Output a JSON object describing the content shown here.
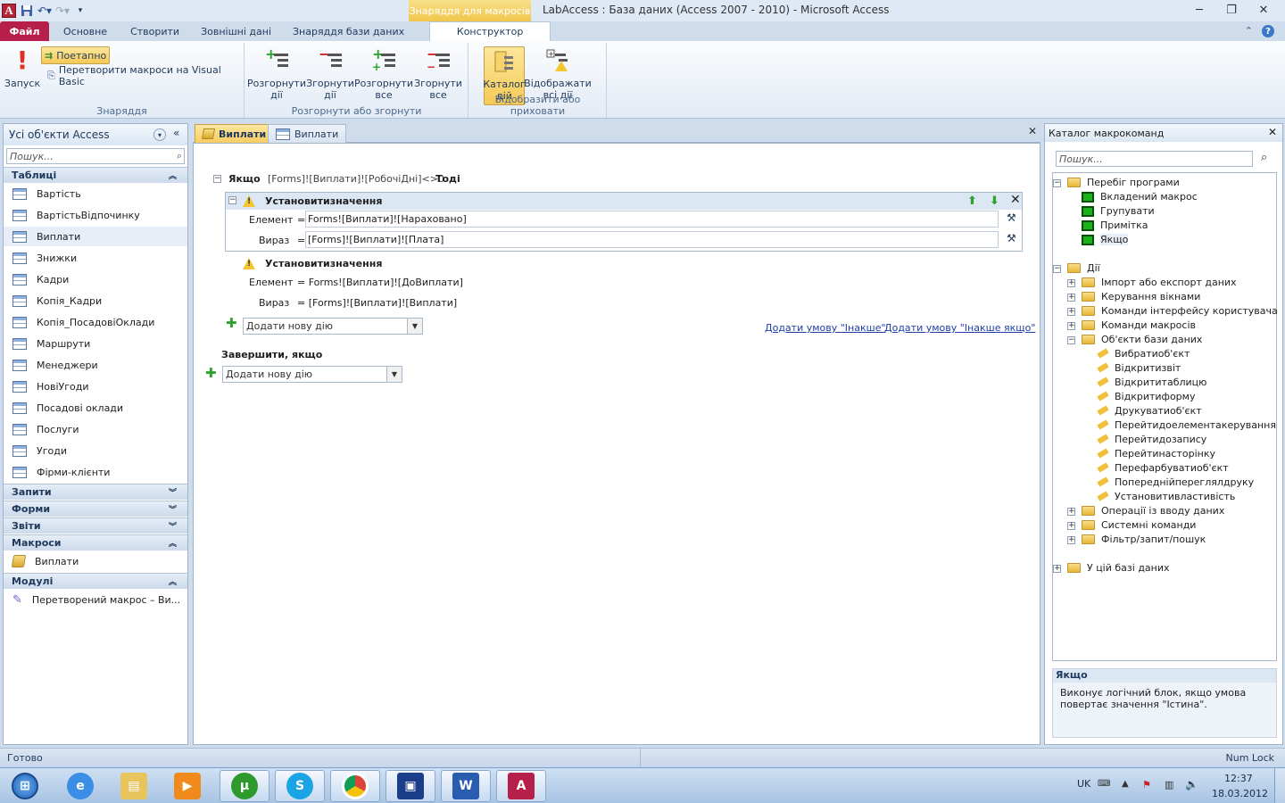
{
  "window": {
    "title": "LabAccess : База даних (Access 2007 - 2010)  -  Microsoft Access",
    "contextual_tab_header": "Знаряддя для макросів"
  },
  "tabs": [
    "Файл",
    "Основне",
    "Створити",
    "Зовнішні дані",
    "Знаряддя бази даних",
    "Конструктор"
  ],
  "ribbon": {
    "tools": {
      "label": "Знаряддя",
      "run": "Запуск",
      "step": "Поетапно",
      "convert": "Перетворити макроси на Visual Basic"
    },
    "expand": {
      "label": "Розгорнути або згорнути",
      "b1": [
        "Розгорнути",
        "дії"
      ],
      "b2": [
        "Згорнути",
        "дії"
      ],
      "b3": [
        "Розгорнути",
        "все"
      ],
      "b4": [
        "Згорнути",
        "все"
      ]
    },
    "show": {
      "label": "Відобразити або приховати",
      "b1": [
        "Каталог",
        "дій"
      ],
      "b2": [
        "Відображати",
        "всі дії"
      ]
    }
  },
  "nav": {
    "header": "Усі об'єкти Access",
    "search_placeholder": "Пошук...",
    "cat_tables": "Таблиці",
    "tables": [
      "Вартість",
      "ВартістьВідпочинку",
      "Виплати",
      "Знижки",
      "Кадри",
      "Копія_Кадри",
      "Копія_ПосадовіОклади",
      "Маршрути",
      "Менеджери",
      "НовіУгоди",
      "Посадові оклади",
      "Послуги",
      "Угоди",
      "Фірми-клієнти"
    ],
    "cat_queries": "Запити",
    "cat_forms": "Форми",
    "cat_reports": "Звіти",
    "cat_macros": "Макроси",
    "macros": [
      "Виплати"
    ],
    "cat_modules": "Модулі",
    "modules": [
      "Перетворений макрос – Ви..."
    ]
  },
  "doc_tabs": [
    "Виплати",
    "Виплати"
  ],
  "macro": {
    "if_kw": "Якщо",
    "if_cond": "[Forms]![Виплати]![РобочіДні]<>0",
    "then_kw": "Тоді",
    "action1": {
      "name": "Установитизначення",
      "elem_label": "Елемент",
      "elem_val": "Forms![Виплати]![Нараховано]",
      "expr_label": "Вираз",
      "expr_val": "[Forms]![Виплати]![Плата]"
    },
    "action2": {
      "name": "Установитизначення",
      "elem_label": "Елемент",
      "elem_val": "= Forms![Виплати]![ДоВиплати]",
      "expr_label": "Вираз",
      "expr_val": "= [Forms]![Виплати]![Виплати]"
    },
    "eq": "=",
    "add_action": "Додати нову дію",
    "add_else": "Додати умову \"Інакше\"",
    "add_elseif": "Додати умову \"Інакше якщо\"",
    "end_if": "Завершити, якщо"
  },
  "catalog": {
    "title": "Каталог макрокоманд",
    "search_placeholder": "Пошук...",
    "program_flow": "Перебіг програми",
    "flow_items": [
      "Вкладений макрос",
      "Групувати",
      "Примітка",
      "Якщо"
    ],
    "actions": "Дії",
    "action_groups": [
      "Імпорт або експорт даних",
      "Керування вікнами",
      "Команди інтерфейсу користувача",
      "Команди макросів",
      "Об'єкти бази даних"
    ],
    "db_object_items": [
      "Вибратиоб'єкт",
      "Відкритизвіт",
      "Відкрититаблицю",
      "Відкритиформу",
      "Друкуватиоб'єкт",
      "Перейтидоелементакерування",
      "Перейтидозапису",
      "Перейтинасторінку",
      "Перефарбуватиоб'єкт",
      "Попереднійпереглялдруку",
      "Установитивластивість"
    ],
    "action_groups2": [
      "Операції із вводу даних",
      "Системні команди",
      "Фільтр/запит/пошук"
    ],
    "in_db": "У цій базі даних",
    "desc_title": "Якщо",
    "desc_text": "Виконує логічний блок, якщо умова повертає значення \"Істина\"."
  },
  "status": {
    "left": "Готово",
    "right": "Num Lock"
  },
  "tray": {
    "lang": "UK",
    "time": "12:37",
    "date": "18.03.2012"
  },
  "colors": {
    "file_tab": "#b51f4a",
    "contextual": "#f1c64b",
    "accent": "#1e395b"
  }
}
